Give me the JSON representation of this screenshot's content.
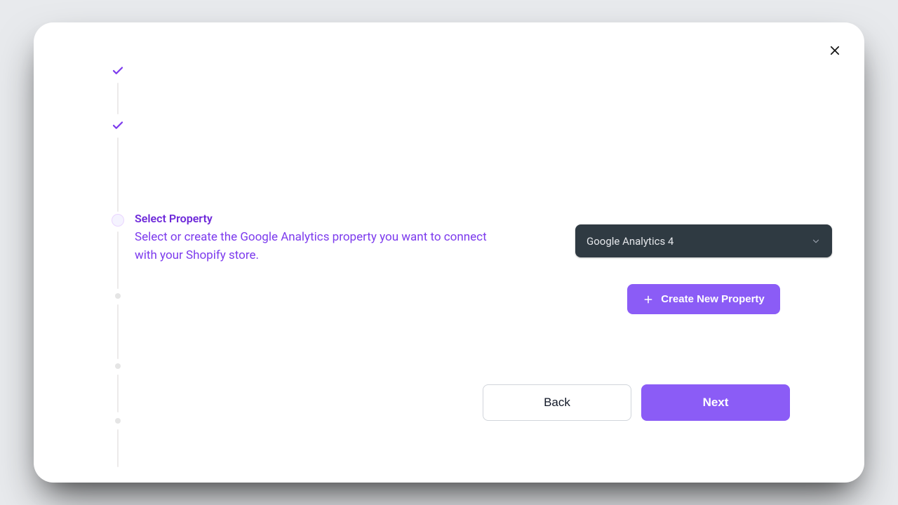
{
  "colors": {
    "accent": "#8b5cf6",
    "accent_dark": "#7c3aed",
    "select_bg": "#2f3a42"
  },
  "dialog": {
    "close_alt": "Close"
  },
  "stepper": {
    "nodes": [
      {
        "kind": "done"
      },
      {
        "kind": "done"
      },
      {
        "kind": "current"
      },
      {
        "kind": "upcoming"
      },
      {
        "kind": "upcoming"
      },
      {
        "kind": "upcoming"
      }
    ],
    "active_step": {
      "title": "Select Property",
      "description": "Select or create the Google Analytics property you want to connect with your Shopify store."
    }
  },
  "controls": {
    "property_select": {
      "selected": "Google Analytics 4"
    },
    "create_property": {
      "label": "Create New Property"
    }
  },
  "footer": {
    "back_label": "Back",
    "next_label": "Next"
  }
}
